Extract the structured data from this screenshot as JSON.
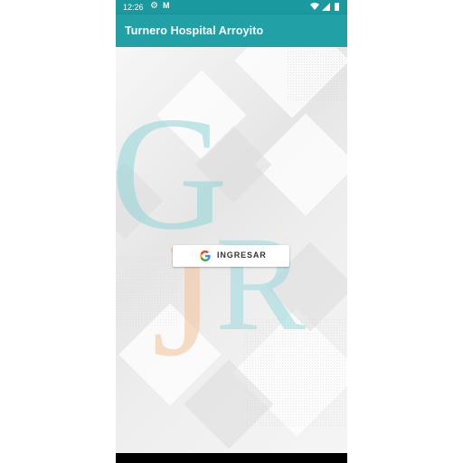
{
  "status_bar": {
    "time": "12:26",
    "icons": [
      "gear-icon",
      "mail-icon",
      "wifi-icon",
      "signal-icon",
      "battery-icon"
    ]
  },
  "app_bar": {
    "title": "Turnero Hospital Arroyito",
    "color": "#21a1a6"
  },
  "logo": {
    "letters": "GJR",
    "colors": {
      "g": "#8fd3d6",
      "j": "#f4c7a1",
      "r": "#9ad9dc"
    }
  },
  "signin": {
    "label": "INGRESAR",
    "icon": "google-g-icon"
  }
}
